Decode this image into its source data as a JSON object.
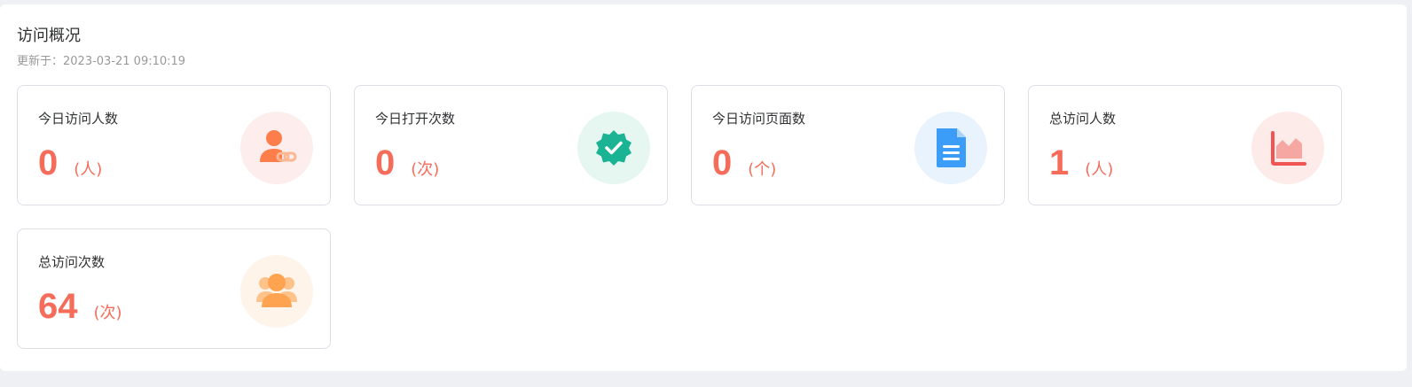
{
  "overview": {
    "title": "访问概况",
    "updated": "更新于：2023-03-21 09:10:19"
  },
  "cards": [
    {
      "label": "今日访问人数",
      "value": "0",
      "unit": "(人)",
      "icon": "user-link-icon",
      "bg": "#fdeeed",
      "fg": "#fd7e4a"
    },
    {
      "label": "今日打开次数",
      "value": "0",
      "unit": "(次)",
      "icon": "verified-badge-icon",
      "bg": "#e6f7f2",
      "fg": "#1ab394"
    },
    {
      "label": "今日访问页面数",
      "value": "0",
      "unit": "(个)",
      "icon": "document-icon",
      "bg": "#e8f3fe",
      "fg": "#3c9df8"
    },
    {
      "label": "总访问人数",
      "value": "1",
      "unit": "(人)",
      "icon": "area-chart-icon",
      "bg": "#fdebea",
      "fg": "#f25454"
    },
    {
      "label": "总访问次数",
      "value": "64",
      "unit": "(次)",
      "icon": "users-icon",
      "bg": "#fef4ea",
      "fg": "#fea350"
    }
  ],
  "colors": {
    "value": "#f56c5a",
    "border": "#dcdfe6",
    "page_bg": "#eef0f4"
  }
}
